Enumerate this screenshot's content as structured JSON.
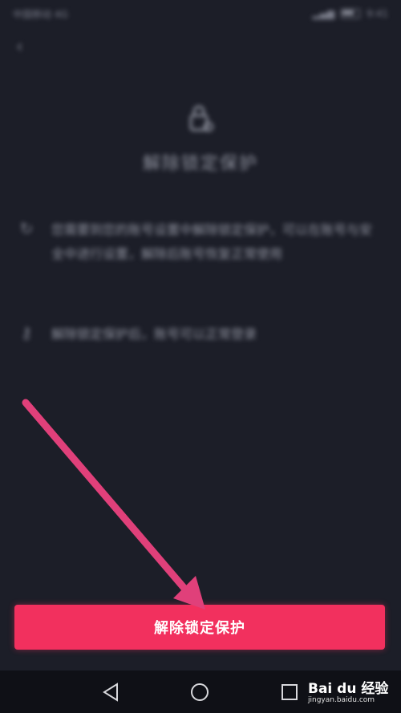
{
  "statusbar": {
    "carrier": "中国移动 4G",
    "right": "9:41"
  },
  "page": {
    "title": "解除锁定保护",
    "info_1": "您需要到您的账号设置中解除锁定保护，可以在账号与安全中进行设置，解除后账号恢复正常使用",
    "info_2": "解除锁定保护后，账号可以正常登录"
  },
  "actions": {
    "unlock_label": "解除锁定保护"
  },
  "watermark": {
    "brand": "Bai du 经验",
    "url": "jingyan.baidu.com"
  },
  "colors": {
    "accent": "#f2305e",
    "annotation": "#e0407a",
    "background": "#1c1e28"
  }
}
